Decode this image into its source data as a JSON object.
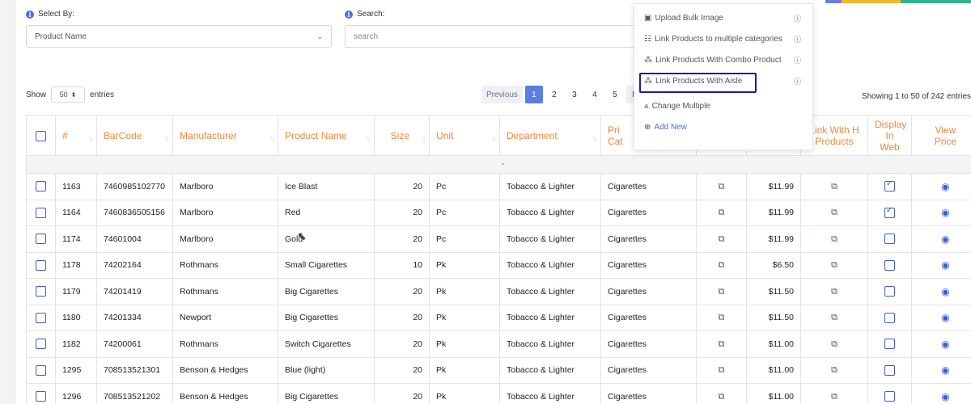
{
  "filters": {
    "select_by_label": "Select By:",
    "select_by_value": "Product Name",
    "search_label": "Search:",
    "search_placeholder": "search"
  },
  "accent_colors": [
    "#6c7bdd",
    "#f5b731",
    "#2fb58f"
  ],
  "show": {
    "show_label": "Show",
    "entries_value": "50",
    "entries_label": "entries"
  },
  "pagination": {
    "previous": "Previous",
    "pages": [
      "1",
      "2",
      "3",
      "4",
      "5"
    ],
    "next_partial": "N",
    "active": "1"
  },
  "showing_text": "Showing 1 to 50 of 242 entries",
  "table": {
    "headers": {
      "num": "#",
      "barcode": "BarCode",
      "manufacturer": "Manufacturer",
      "product_name": "Product Name",
      "size": "Size",
      "unit": "Unit",
      "department": "Department",
      "pri_cat_1": "Pri",
      "pri_cat_2": "Cat",
      "link_h_1": "Link With H",
      "link_h_2": "Products",
      "display_1": "Display",
      "display_2": "In Web",
      "view_1": "View",
      "view_2": "Price"
    },
    "separator": "-",
    "rows": [
      {
        "id": "1163",
        "barcode": "7460985102770",
        "manufacturer": "Marlboro",
        "product": "Ice Blast",
        "size": "20",
        "unit": "Pc",
        "department": "Tobacco & Lighter",
        "category": "Cigarettes",
        "price": "$11.99",
        "display": true
      },
      {
        "id": "1164",
        "barcode": "7460836505156",
        "manufacturer": "Marlboro",
        "product": "Red",
        "size": "20",
        "unit": "Pc",
        "department": "Tobacco & Lighter",
        "category": "Cigarettes",
        "price": "$11.99",
        "display": true
      },
      {
        "id": "1174",
        "barcode": "74601004",
        "manufacturer": "Marlboro",
        "product": "Gold",
        "size": "20",
        "unit": "Pc",
        "department": "Tobacco & Lighter",
        "category": "Cigarettes",
        "price": "$11.99",
        "display": false
      },
      {
        "id": "1178",
        "barcode": "74202164",
        "manufacturer": "Rothmans",
        "product": "Small Cigarettes",
        "size": "10",
        "unit": "Pk",
        "department": "Tobacco & Lighter",
        "category": "Cigarettes",
        "price": "$6.50",
        "display": false
      },
      {
        "id": "1179",
        "barcode": "74201419",
        "manufacturer": "Rothmans",
        "product": "Big Cigarettes",
        "size": "20",
        "unit": "Pk",
        "department": "Tobacco & Lighter",
        "category": "Cigarettes",
        "price": "$11.50",
        "display": false
      },
      {
        "id": "1180",
        "barcode": "74201334",
        "manufacturer": "Newport",
        "product": "Big Cigarettes",
        "size": "20",
        "unit": "Pk",
        "department": "Tobacco & Lighter",
        "category": "Cigarettes",
        "price": "$11.50",
        "display": false
      },
      {
        "id": "1182",
        "barcode": "74200061",
        "manufacturer": "Rothmans",
        "product": "Switch Cigarettes",
        "size": "20",
        "unit": "Pk",
        "department": "Tobacco & Lighter",
        "category": "Cigarettes",
        "price": "$11.00",
        "display": false
      },
      {
        "id": "1295",
        "barcode": "708513521301",
        "manufacturer": "Benson & Hedges",
        "product": "Blue (light)",
        "size": "20",
        "unit": "Pk",
        "department": "Tobacco & Lighter",
        "category": "Cigarettes",
        "price": "$11.00",
        "display": false
      },
      {
        "id": "1296",
        "barcode": "708513521202",
        "manufacturer": "Benson & Hedges",
        "product": "Big Cigarettes",
        "size": "20",
        "unit": "Pk",
        "department": "Tobacco & Lighter",
        "category": "Cigarettes",
        "price": "$11.00",
        "display": false
      }
    ]
  },
  "dropdown": {
    "items": [
      {
        "label": "Upload Bulk Image",
        "icon": "image-icon"
      },
      {
        "label": "Link Products to multiple categories",
        "icon": "categories-icon"
      },
      {
        "label": "Link Products With Combo Product",
        "icon": "combo-icon"
      },
      {
        "label": "Link Products With Aisle",
        "icon": "aisle-icon"
      },
      {
        "label": "Change Multiple",
        "icon": "change-multiple-icon"
      },
      {
        "label": "Add New",
        "icon": "add-circle-icon"
      }
    ]
  }
}
